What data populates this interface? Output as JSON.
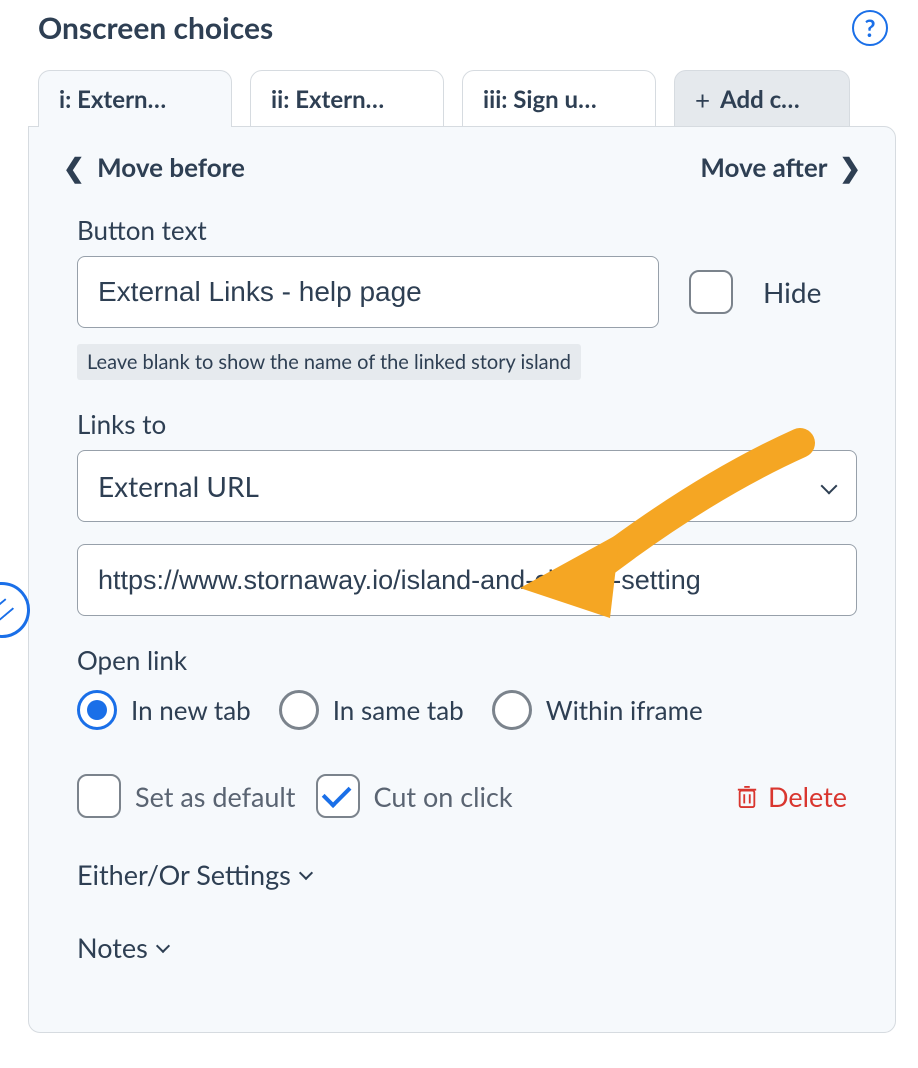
{
  "title": "Onscreen choices",
  "tabs": {
    "t1": "i: Extern…",
    "t2": "ii: Extern…",
    "t3": "iii: Sign u…",
    "add": "Add c…"
  },
  "move_before": "Move before",
  "move_after": "Move after",
  "button_text": {
    "label": "Button text",
    "value": "External Links - help page",
    "hint": "Leave blank to show the name of the linked story island"
  },
  "hide_label": "Hide",
  "links_to": {
    "label": "Links to",
    "selected": "External URL",
    "url": "https://www.stornaway.io/island-and-choice-setting"
  },
  "open_link": {
    "label": "Open link",
    "opt1": "In new tab",
    "opt2": "In same tab",
    "opt3": "Within iframe"
  },
  "set_default": "Set as default",
  "cut_on_click": "Cut on click",
  "delete": "Delete",
  "either_or": "Either/Or Settings",
  "notes": "Notes"
}
